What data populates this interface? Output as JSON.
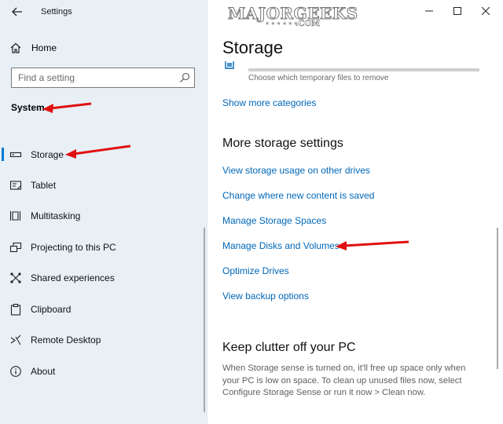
{
  "window": {
    "title": "Settings"
  },
  "watermark": {
    "text": "MAJORGEEKS",
    "suffix": ".COM"
  },
  "sidebar": {
    "home_label": "Home",
    "search": {
      "placeholder": "Find a setting"
    },
    "section_heading": "System",
    "items": [
      {
        "label": "Storage",
        "icon": "storage-icon",
        "selected": true
      },
      {
        "label": "Tablet",
        "icon": "tablet-icon"
      },
      {
        "label": "Multitasking",
        "icon": "multitasking-icon"
      },
      {
        "label": "Projecting to this PC",
        "icon": "projecting-icon"
      },
      {
        "label": "Shared experiences",
        "icon": "shared-experiences-icon"
      },
      {
        "label": "Clipboard",
        "icon": "clipboard-icon"
      },
      {
        "label": "Remote Desktop",
        "icon": "remote-desktop-icon"
      },
      {
        "label": "About",
        "icon": "about-icon"
      }
    ]
  },
  "main": {
    "title": "Storage",
    "temp_files": {
      "description": "Choose which temporary files to remove"
    },
    "show_more": "Show more categories",
    "more_settings": {
      "heading": "More storage settings",
      "links": [
        "View storage usage on other drives",
        "Change where new content is saved",
        "Manage Storage Spaces",
        "Manage Disks and Volumes",
        "Optimize Drives",
        "View backup options"
      ]
    },
    "clutter": {
      "heading": "Keep clutter off your PC",
      "text": "When Storage sense is turned on, it'll free up space only when your PC is low on space. To clean up unused files now, select Configure Storage Sense or run it now > Clean now."
    }
  },
  "colors": {
    "accent": "#0078d7",
    "link": "#0067b8",
    "annotation_arrow": "#e01010",
    "sidebar_bg": "#e8f0f6"
  }
}
